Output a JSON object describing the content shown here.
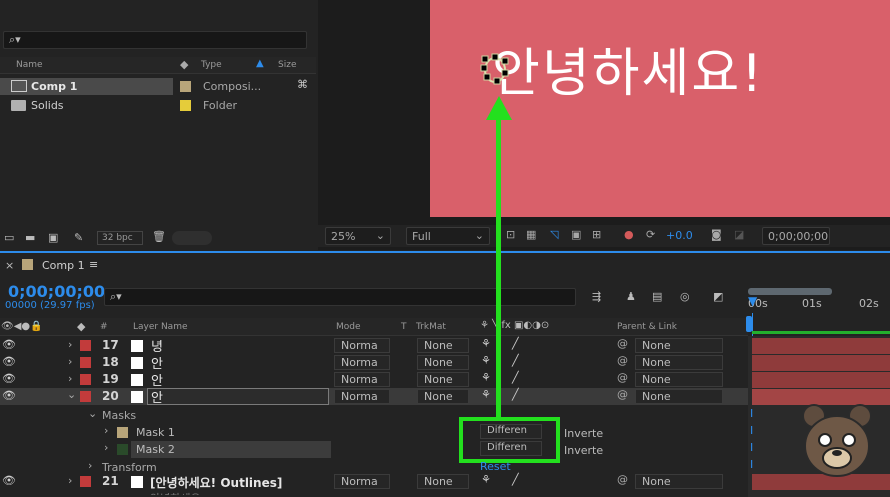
{
  "project": {
    "search_icon": "search-icon",
    "columns": {
      "name": "Name",
      "type": "Type",
      "size": "Size"
    },
    "items": [
      {
        "name": "Comp 1",
        "type": "Composi...",
        "color": "#b8a57a"
      },
      {
        "name": "Solids",
        "type": "Folder",
        "color": "#e5cc3a"
      }
    ],
    "bpc": "32 bpc"
  },
  "viewer": {
    "text": "안녕하세요!",
    "zoom": "25%",
    "resolution": "Full",
    "exposure": "+0.0",
    "timecode": "0;00;00;00",
    "bg_color": "#d9606a"
  },
  "timeline": {
    "tab": "Comp 1",
    "menu_icon": "≡",
    "timecode": "0;00;00;00",
    "frames": "00000 (29.97 fps)",
    "columns": {
      "layer_name": "Layer Name",
      "mode": "Mode",
      "t": "T",
      "trkmat": "TrkMat",
      "parent": "Parent & Link",
      "hash": "#"
    },
    "ruler": [
      "00s",
      "01s",
      "02s"
    ],
    "layers": [
      {
        "num": "17",
        "name": "녕",
        "mode": "Norma",
        "trk": "None",
        "parent": "None"
      },
      {
        "num": "18",
        "name": "안",
        "mode": "Norma",
        "trk": "None",
        "parent": "None"
      },
      {
        "num": "19",
        "name": "안",
        "mode": "Norma",
        "trk": "None",
        "parent": "None"
      },
      {
        "num": "20",
        "name": "안",
        "mode": "Norma",
        "trk": "None",
        "parent": "None"
      }
    ],
    "masks_label": "Masks",
    "masks": [
      {
        "name": "Mask 1",
        "mode": "Differen",
        "inverted": "Inverte"
      },
      {
        "name": "Mask 2",
        "mode": "Differen",
        "inverted": "Inverte"
      }
    ],
    "transform": "Transform",
    "reset": "Reset",
    "layer21": {
      "num": "21",
      "name": "[안녕하세요! Outlines]",
      "mode": "Norma",
      "trk": "None",
      "parent": "None"
    },
    "partial_row": "안녕하세요"
  }
}
